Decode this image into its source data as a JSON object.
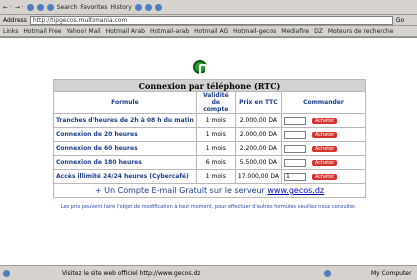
{
  "toolbar": {
    "back_label": "← ·",
    "forward_label": "→ ·",
    "search_label": "Search",
    "favorites_label": "Favorites",
    "history_label": "History"
  },
  "address": {
    "label": "Address",
    "url": "http://tipgecos.multimania.com",
    "go_label": "Go"
  },
  "links": {
    "label": "Links",
    "items": [
      "Hotmail Free",
      "Yahoo! Mail",
      "Hotmail Arab",
      "Hotmail-arab",
      "Hotmail AG",
      "Hotmail-gecos",
      "Mediafire",
      "DZ",
      "Moteurs de recherche"
    ]
  },
  "page": {
    "title": "Connexion par téléphone (RTC)",
    "headers": [
      "Formule",
      "Validité de compte",
      "Prix en TTC",
      "Commander"
    ],
    "rows": [
      {
        "offer": "Tranches d'heures de 2h à 08 h du matin",
        "validity": "1 mois",
        "price": "2.000,00 DA",
        "qty": "",
        "buy": "Acheter"
      },
      {
        "offer": "Connexion de 20 heures",
        "validity": "1 mois",
        "price": "2.000,00 DA",
        "qty": "",
        "buy": "Acheter"
      },
      {
        "offer": "Connexion de 60 heures",
        "validity": "1 mois",
        "price": "2.200,00 DA",
        "qty": "",
        "buy": "Acheter"
      },
      {
        "offer": "Connexion de 180 heures",
        "validity": "6 mois",
        "price": "5.500,00 DA",
        "qty": "",
        "buy": "Acheter"
      },
      {
        "offer": "Accès illimité 24/24 heures (Cybercafé)",
        "validity": "1 mois",
        "price": "17.000,00 DA",
        "qty": "1",
        "buy": "Acheter"
      }
    ],
    "promo_text": "+ Un Compte E-mail Gratuit sur le serveur",
    "promo_link": "www.gecos.dz",
    "notice": "Les prix peuvent faire l'objet de modification à tout moment, pour effectuer d'autres formules veuillez nous consulter."
  },
  "status": {
    "text": "Visitez le site web officiel http://www.gecos.dz",
    "zone": "My Computer"
  }
}
